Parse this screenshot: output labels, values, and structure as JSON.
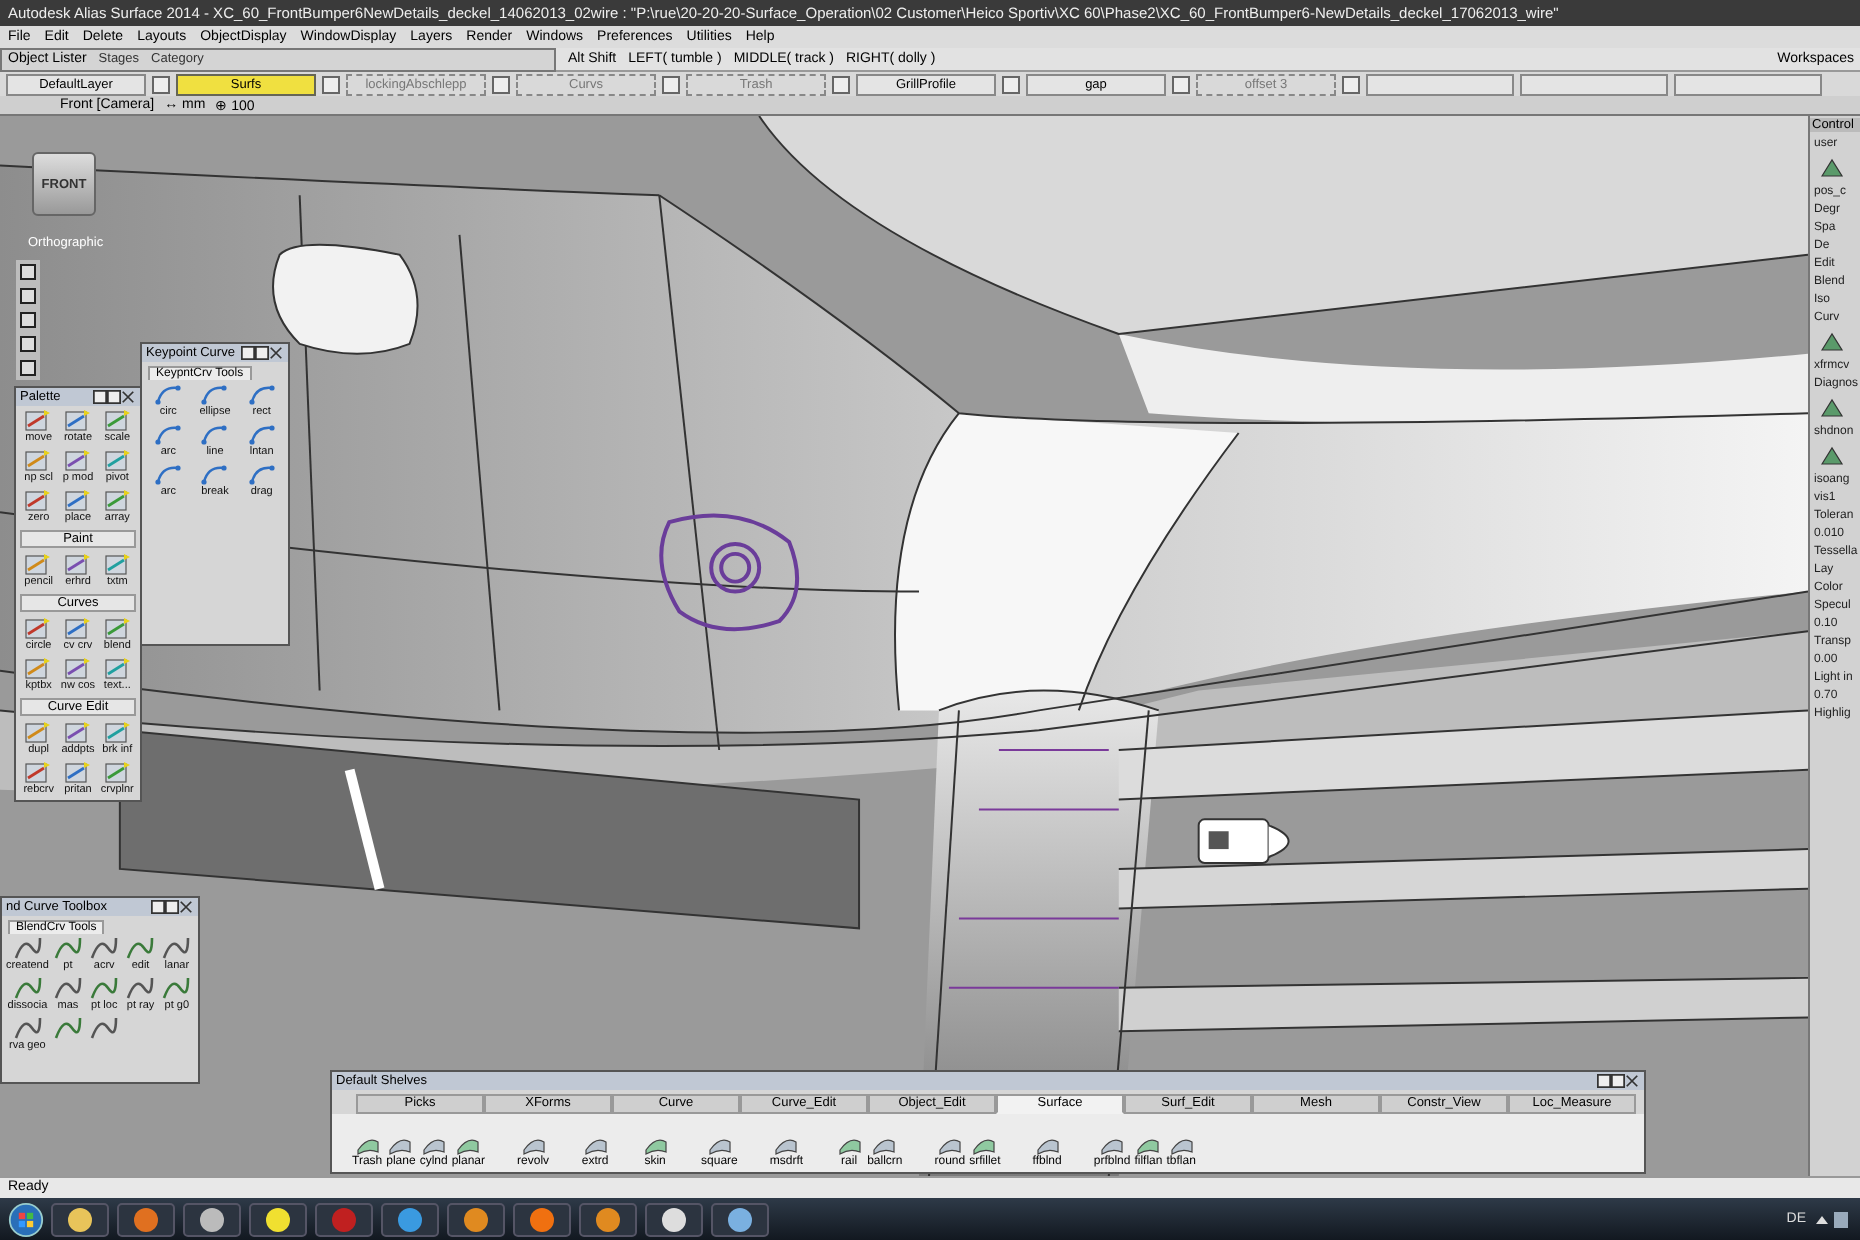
{
  "window": {
    "title": "Autodesk Alias Surface 2014   - XC_60_FrontBumper6NewDetails_deckel_14062013_02wire : \"P:\\rue\\20-20-20-Surface_Operation\\02 Customer\\Heico Sportiv\\XC 60\\Phase2\\XC_60_FrontBumper6-NewDetails_deckel_17062013_wire\""
  },
  "menu": [
    "File",
    "Edit",
    "Delete",
    "Layouts",
    "ObjectDisplay",
    "WindowDisplay",
    "Layers",
    "Render",
    "Windows",
    "Preferences",
    "Utilities",
    "Help"
  ],
  "object_lister": {
    "title": "Object Lister",
    "tabs": [
      "Stages",
      "Category"
    ]
  },
  "mouse_hint": [
    "Alt Shift",
    "LEFT( tumble )",
    "MIDDLE( track )",
    "RIGHT( dolly )"
  ],
  "workspaces": "Workspaces",
  "layers": [
    {
      "label": "DefaultLayer",
      "selected": false,
      "visible": true,
      "checked": false
    },
    {
      "label": "Surfs",
      "selected": true,
      "visible": true,
      "checked": false
    },
    {
      "label": "lockingAbschlepp",
      "selected": false,
      "visible": false,
      "checked": false
    },
    {
      "label": "Curvs",
      "selected": false,
      "visible": false,
      "checked": false
    },
    {
      "label": "Trash",
      "selected": false,
      "visible": false,
      "checked": false
    },
    {
      "label": "GrillProfile",
      "selected": false,
      "visible": true,
      "checked": false
    },
    {
      "label": "gap",
      "selected": false,
      "visible": true,
      "checked": false
    },
    {
      "label": "offset 3",
      "selected": false,
      "visible": false,
      "checked": false
    }
  ],
  "viewport": {
    "camera": "Front [Camera]",
    "units": "↔ mm",
    "zoom": "⊕ 100",
    "view_cube": "FRONT",
    "projection": "Orthographic"
  },
  "palette": {
    "title": "Palette",
    "groups": [
      {
        "tools": [
          "move",
          "rotate",
          "scale",
          "np scl",
          "p mod",
          "pivot",
          "zero",
          "place",
          "array"
        ]
      },
      {
        "title": "Paint",
        "tools": [
          "pencil",
          "erhrd",
          "txtm"
        ]
      },
      {
        "title": "Curves",
        "tools": [
          "circle",
          "cv crv",
          "blend",
          "kptbx",
          "nw cos",
          "text..."
        ]
      },
      {
        "title": "Curve Edit",
        "tools": [
          "dupl",
          "addpts",
          "brk inf",
          "rebcrv",
          "pritan",
          "crvplnr"
        ]
      }
    ]
  },
  "keypoint": {
    "title": "Keypoint Curve",
    "tab": {
      "label": "KeypntCrv Tools",
      "selected": true
    },
    "tools": [
      "circ",
      "ellipse",
      "rect",
      "arc",
      "line",
      "lntan",
      "arc",
      "break",
      "drag"
    ]
  },
  "blend": {
    "title": "nd Curve Toolbox",
    "tab": {
      "label": "BlendCrv Tools",
      "selected": true
    },
    "tools": [
      {
        "kind": "tool",
        "label": "creatend"
      },
      {
        "kind": "tool",
        "label": "pt"
      },
      {
        "kind": "tool",
        "label": "acrv"
      },
      {
        "kind": "tool",
        "label": "edit"
      },
      {
        "kind": "tool",
        "label": "lanar"
      },
      {
        "kind": "tool",
        "label": "dissocia"
      },
      {
        "kind": "tool",
        "label": "mas"
      },
      {
        "kind": "tool",
        "label": "pt loc"
      },
      {
        "kind": "tool",
        "label": "pt ray"
      },
      {
        "kind": "tool",
        "label": "pt g0"
      },
      {
        "kind": "tool",
        "label": "rva geo"
      },
      {
        "kind": "icon"
      },
      {
        "kind": "icon"
      }
    ]
  },
  "shelves": {
    "title": "Default Shelves",
    "tabs": [
      {
        "label": "Picks",
        "selected": false
      },
      {
        "label": "XForms",
        "selected": false
      },
      {
        "label": "Curve",
        "selected": false
      },
      {
        "label": "Curve_Edit",
        "selected": false
      },
      {
        "label": "Object_Edit",
        "selected": false
      },
      {
        "label": "Surface",
        "selected": true
      },
      {
        "label": "Surf_Edit",
        "selected": false
      },
      {
        "label": "Mesh",
        "selected": false
      },
      {
        "label": "Constr_View",
        "selected": false
      },
      {
        "label": "Loc_Measure",
        "selected": false
      }
    ],
    "tools": [
      "Trash",
      "plane",
      "cylnd",
      "planar",
      "revolv",
      "extrd",
      "skin",
      "square",
      "msdrft",
      "rail",
      "ballcrn",
      "round",
      "srfillet",
      "ffblnd",
      "prfblnd",
      "filflan",
      "tbflan"
    ]
  },
  "control_panel": {
    "title": "Control",
    "texts": [
      "user",
      "pos_c",
      "Degr",
      "Spa",
      "De",
      "Edit",
      "Blend",
      "Iso",
      "Curv",
      "xfrmcv",
      "Diagnos",
      "shdnon",
      "isoang",
      "vis1",
      "Toleran",
      "0.010",
      "Tessella",
      "Lay",
      "Color",
      "Specul",
      "0.10",
      "Transp",
      "0.00",
      "Light in",
      "0.70",
      "Highlig"
    ]
  },
  "status_bar": "Ready",
  "taskbar": {
    "language": "DE"
  }
}
